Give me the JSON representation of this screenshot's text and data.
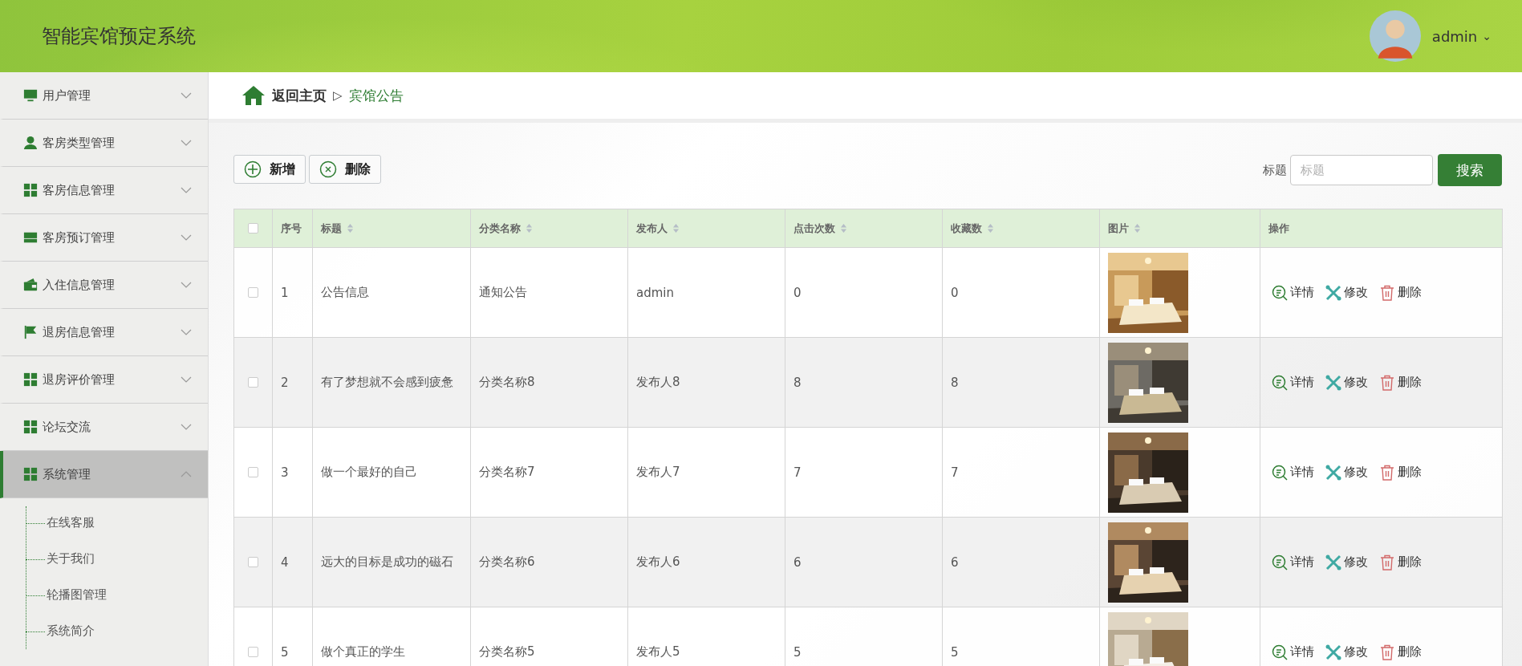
{
  "header": {
    "title": "智能宾馆预定系统",
    "user": {
      "name": "admin",
      "caret": "⌄"
    }
  },
  "sidebar": {
    "items": [
      {
        "label": "用户管理",
        "expanded": false,
        "selected": false
      },
      {
        "label": "客房类型管理",
        "expanded": false,
        "selected": false
      },
      {
        "label": "客房信息管理",
        "expanded": false,
        "selected": false
      },
      {
        "label": "客房预订管理",
        "expanded": false,
        "selected": false
      },
      {
        "label": "入住信息管理",
        "expanded": false,
        "selected": false
      },
      {
        "label": "退房信息管理",
        "expanded": false,
        "selected": false
      },
      {
        "label": "退房评价管理",
        "expanded": false,
        "selected": false
      },
      {
        "label": "论坛交流",
        "expanded": false,
        "selected": false
      },
      {
        "label": "系统管理",
        "expanded": true,
        "selected": true,
        "children": [
          {
            "label": "在线客服"
          },
          {
            "label": "关于我们"
          },
          {
            "label": "轮播图管理"
          },
          {
            "label": "系统简介"
          }
        ]
      }
    ]
  },
  "breadcrumb": {
    "home": "返回主页",
    "separator": "▷",
    "current": "宾馆公告"
  },
  "toolbar": {
    "buttons": [
      {
        "label": "新增",
        "kind": "add"
      },
      {
        "label": "删除",
        "kind": "delete"
      }
    ],
    "search": {
      "label": "标题",
      "placeholder": "标题",
      "button": "搜索"
    }
  },
  "table": {
    "header_checked": false,
    "columns": [
      {
        "label": "序号",
        "sortable": false
      },
      {
        "label": "标题",
        "sortable": true
      },
      {
        "label": "分类名称",
        "sortable": true
      },
      {
        "label": "发布人",
        "sortable": true
      },
      {
        "label": "点击次数",
        "sortable": true
      },
      {
        "label": "收藏数",
        "sortable": true
      },
      {
        "label": "图片",
        "sortable": true
      },
      {
        "label": "操作",
        "sortable": false
      }
    ],
    "rows": [
      {
        "checked": false,
        "cells": [
          "1",
          "公告信息",
          "通知公告",
          "admin",
          "0",
          "0"
        ],
        "picture": {
          "kind": "picture"
        },
        "actions": [
          "详情",
          "修改",
          "删除"
        ]
      },
      {
        "checked": false,
        "cells": [
          "2",
          "有了梦想就不会感到疲惫",
          "分类名称8",
          "发布人8",
          "8",
          "8"
        ],
        "picture": {
          "kind": "picture"
        },
        "actions": [
          "详情",
          "修改",
          "删除"
        ]
      },
      {
        "checked": false,
        "cells": [
          "3",
          "做一个最好的自己",
          "分类名称7",
          "发布人7",
          "7",
          "7"
        ],
        "picture": {
          "kind": "picture"
        },
        "actions": [
          "详情",
          "修改",
          "删除"
        ]
      },
      {
        "checked": false,
        "cells": [
          "4",
          "远大的目标是成功的磁石",
          "分类名称6",
          "发布人6",
          "6",
          "6"
        ],
        "picture": {
          "kind": "picture"
        },
        "actions": [
          "详情",
          "修改",
          "删除"
        ]
      },
      {
        "checked": false,
        "cells": [
          "5",
          "做个真正的学生",
          "分类名称5",
          "发布人5",
          "5",
          "5"
        ],
        "picture": {
          "kind": "picture"
        },
        "actions": [
          "详情",
          "修改",
          "删除"
        ]
      }
    ]
  }
}
